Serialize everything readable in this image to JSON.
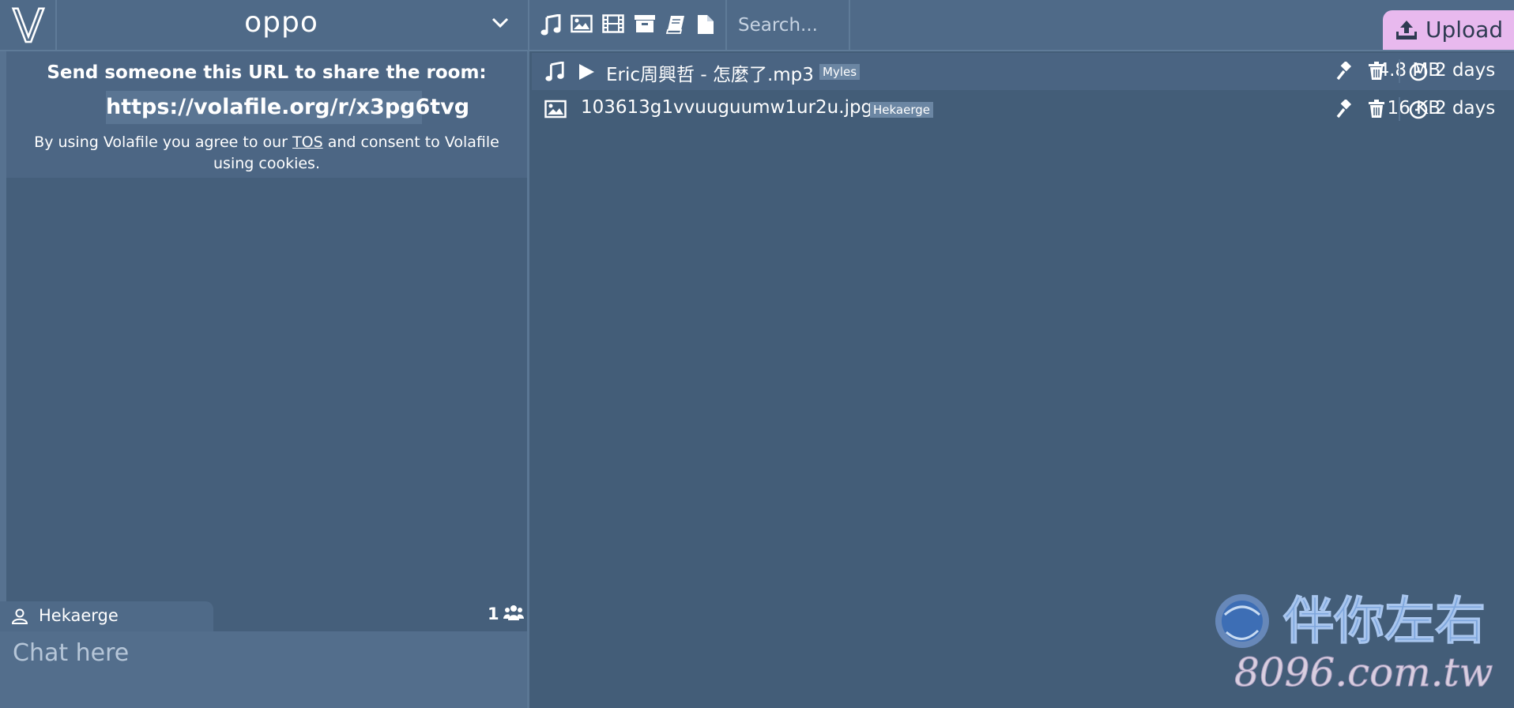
{
  "header": {
    "logo_letter": "V",
    "room_name": "oppo",
    "filters": [
      {
        "name": "music-filter",
        "icon": "music-icon"
      },
      {
        "name": "image-filter",
        "icon": "image-icon"
      },
      {
        "name": "video-filter",
        "icon": "film-icon"
      },
      {
        "name": "archive-filter",
        "icon": "archive-icon"
      },
      {
        "name": "book-filter",
        "icon": "book-icon"
      },
      {
        "name": "document-filter",
        "icon": "file-icon"
      }
    ],
    "search_placeholder": "Search...",
    "upload_label": "Upload"
  },
  "share": {
    "title": "Send someone this URL to share the room:",
    "url": "https://volafile.org/r/x3pg6tvg",
    "tos_prefix": "By using Volafile you agree to our",
    "tos_link": "TOS",
    "tos_suffix": "and consent to Volafile using cookies."
  },
  "chat": {
    "user_name": "Hekaerge",
    "user_count": "1",
    "placeholder": "Chat here"
  },
  "files": [
    {
      "type_icon": "music-icon",
      "name": "Eric周興哲 - 怎麼了.mp3",
      "uploader": "Myles",
      "size": "4.8 MB",
      "expiry": "2 days"
    },
    {
      "type_icon": "image-icon",
      "name": "103613g1vvuuguumw1ur2u.jpg",
      "uploader": "Hekaerge",
      "size": "16 KB",
      "expiry": "2 days"
    }
  ],
  "watermark": {
    "title": "伴你左右",
    "subtitle": "8096.com.tw"
  },
  "colors": {
    "background": "#435d78",
    "header": "#4f6a88",
    "upload_button": "#e8b9ee",
    "tag": "#6b86a3"
  }
}
